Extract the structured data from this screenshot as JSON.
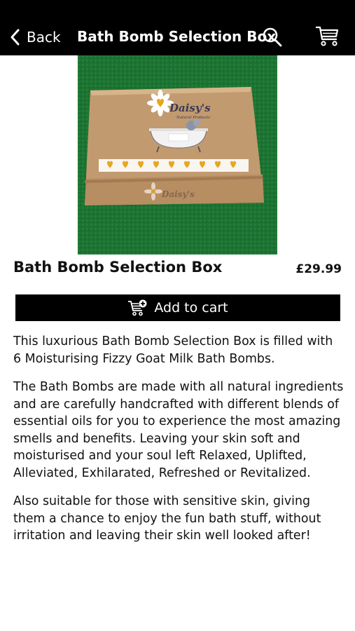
{
  "header": {
    "back_label": "Back",
    "title": "Bath Bomb Selection Box",
    "search_icon": "search-icon",
    "cart_icon": "cart-icon"
  },
  "product": {
    "image_alt": "Bath Bomb Selection Box",
    "box_brand": "Daisy's",
    "box_subtitle": "Natural Products",
    "name": "Bath Bomb Selection Box",
    "price": "£29.99",
    "add_to_cart_label": "Add to cart",
    "description": [
      "This luxurious Bath Bomb Selection Box is filled with 6 Moisturising Fizzy Goat Milk Bath Bombs.",
      "The Bath Bombs are made with all natural ingredients and are carefully handcrafted with different blends of essential oils for you to experience the most amazing smells and benefits. Leaving your skin soft and moisturised and your soul left Relaxed, Uplifted, Alleviated, Exhilarated, Refreshed or Revitalized.",
      "Also suitable for those with sensitive skin, giving them a chance to enjoy the fun bath stuff, without irritation and leaving their skin well looked after!"
    ]
  },
  "colors": {
    "header_bg": "#000000",
    "button_bg": "#000000",
    "text": "#111111",
    "grass": "#1f7a35",
    "box": "#c9a27a"
  }
}
